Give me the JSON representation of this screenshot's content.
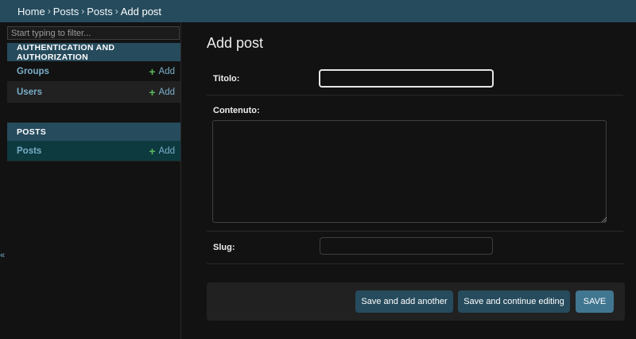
{
  "breadcrumbs": {
    "home": "Home",
    "sep": "›",
    "app": "Posts",
    "model": "Posts",
    "current": "Add post"
  },
  "sidebar": {
    "filter_placeholder": "Start typing to filter...",
    "apps": [
      {
        "caption": "AUTHENTICATION AND AUTHORIZATION",
        "models": [
          {
            "name": "Groups",
            "add_label": "Add"
          },
          {
            "name": "Users",
            "add_label": "Add"
          }
        ]
      },
      {
        "caption": "POSTS",
        "models": [
          {
            "name": "Posts",
            "add_label": "Add"
          }
        ]
      }
    ],
    "add_symbol": "+",
    "collapse_symbol": "«"
  },
  "main": {
    "title": "Add post",
    "fields": {
      "titolo": {
        "label": "Titolo:",
        "value": ""
      },
      "contenuto": {
        "label": "Contenuto:",
        "value": ""
      },
      "slug": {
        "label": "Slug:",
        "value": ""
      }
    },
    "buttons": {
      "save_add_another": "Save and add another",
      "save_continue": "Save and continue editing",
      "save": "SAVE"
    }
  },
  "colors": {
    "header": "#264b5d",
    "link": "#79aec8",
    "add_plus": "#5cb85c",
    "primary_button": "#417690",
    "background": "#121212"
  }
}
